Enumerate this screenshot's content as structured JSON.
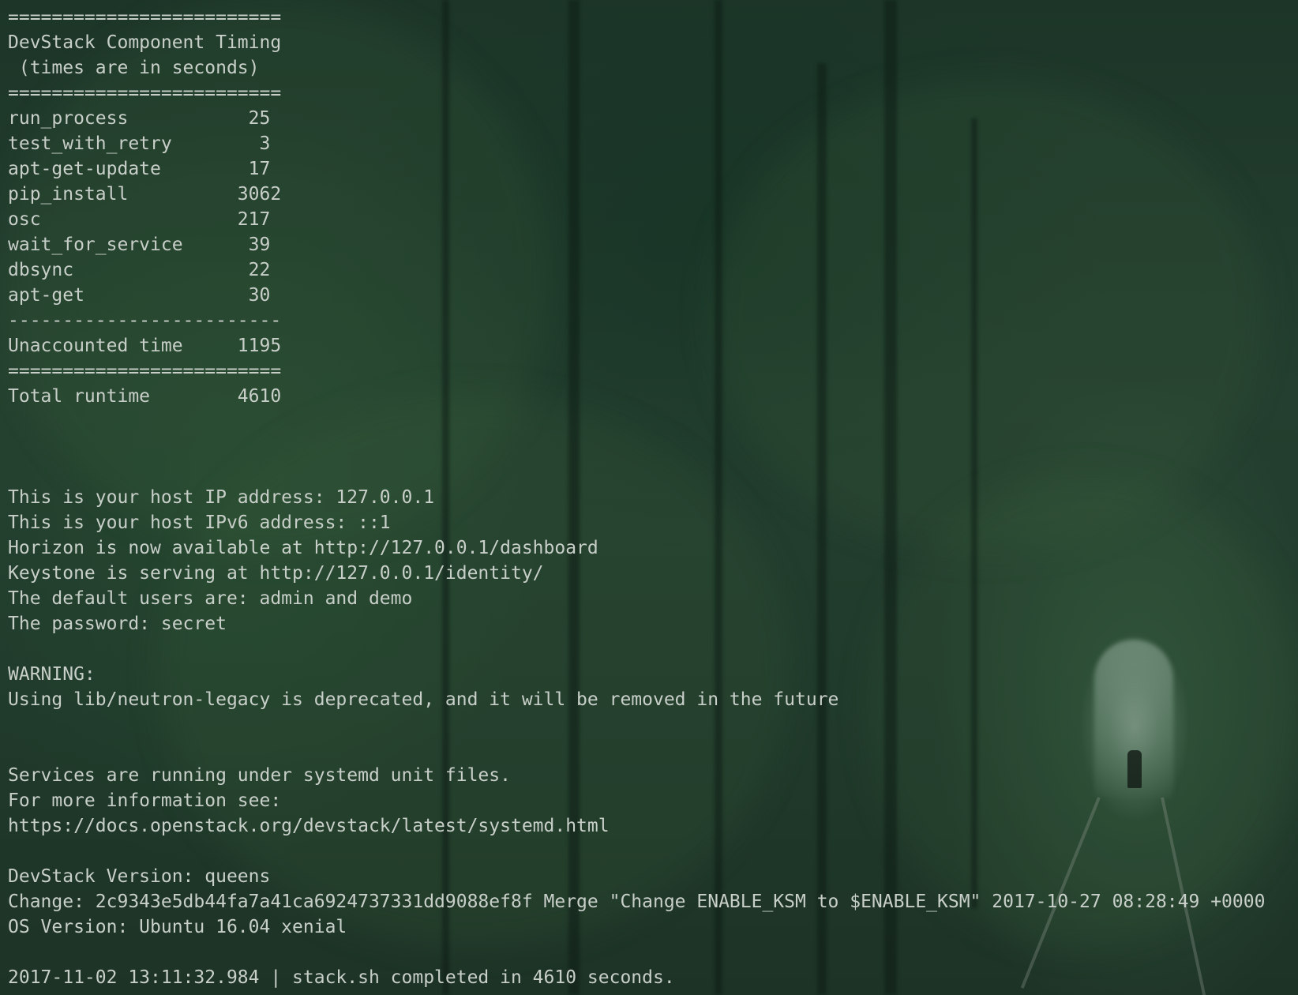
{
  "terminal": {
    "timing_header": {
      "separator_top": "=========================",
      "title": "DevStack Component Timing",
      "subtitle": " (times are in seconds)",
      "separator_mid": "========================="
    },
    "timing_rows": [
      {
        "name": "run_process",
        "value": "25"
      },
      {
        "name": "test_with_retry",
        "value": "3"
      },
      {
        "name": "apt-get-update",
        "value": "17"
      },
      {
        "name": "pip_install",
        "value": "3062"
      },
      {
        "name": "osc",
        "value": "217"
      },
      {
        "name": "wait_for_service",
        "value": "39"
      },
      {
        "name": "dbsync",
        "value": "22"
      },
      {
        "name": "apt-get",
        "value": "30"
      }
    ],
    "dash_separator": "-------------------------",
    "unaccounted": {
      "name": "Unaccounted time",
      "value": "1195"
    },
    "separator_bottom": "=========================",
    "total": {
      "name": "Total runtime",
      "value": "4610"
    },
    "info_lines": [
      "This is your host IP address: 127.0.0.1",
      "This is your host IPv6 address: ::1",
      "Horizon is now available at http://127.0.0.1/dashboard",
      "Keystone is serving at http://127.0.0.1/identity/",
      "The default users are: admin and demo",
      "The password: secret"
    ],
    "warning_label": "WARNING:",
    "warning_text": "Using lib/neutron-legacy is deprecated, and it will be removed in the future",
    "systemd_lines": [
      "Services are running under systemd unit files.",
      "For more information see:",
      "https://docs.openstack.org/devstack/latest/systemd.html"
    ],
    "version_lines": [
      "DevStack Version: queens",
      "Change: 2c9343e5db44fa7a41ca6924737331dd9088ef8f Merge \"Change ENABLE_KSM to $ENABLE_KSM\" 2017-10-27 08:28:49 +0000",
      "OS Version: Ubuntu 16.04 xenial"
    ],
    "completion_line": "2017-11-02 13:11:32.984 | stack.sh completed in 4610 seconds."
  },
  "colors": {
    "text": "#c8cfc9",
    "background": "#1e3427"
  }
}
